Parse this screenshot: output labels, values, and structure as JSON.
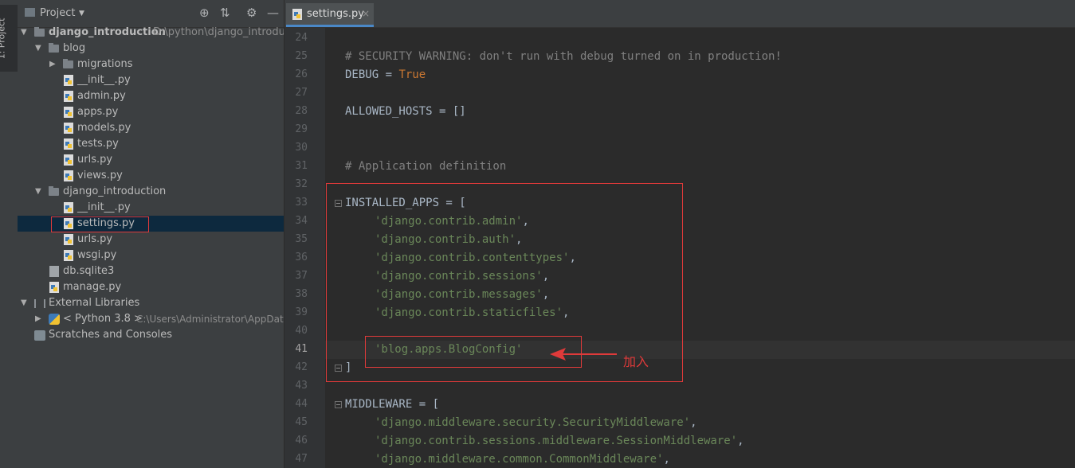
{
  "toolwindow_strip": {
    "label": "1: Project"
  },
  "project_panel": {
    "title": "Project",
    "tree": [
      {
        "label": "django_introduction",
        "hint": "D:\\python\\django_introducti",
        "type": "root"
      },
      {
        "label": "blog",
        "type": "folder"
      },
      {
        "label": "migrations",
        "type": "folder"
      },
      {
        "label": "__init__.py",
        "type": "py"
      },
      {
        "label": "admin.py",
        "type": "py"
      },
      {
        "label": "apps.py",
        "type": "py"
      },
      {
        "label": "models.py",
        "type": "py"
      },
      {
        "label": "tests.py",
        "type": "py"
      },
      {
        "label": "urls.py",
        "type": "py"
      },
      {
        "label": "views.py",
        "type": "py"
      },
      {
        "label": "django_introduction",
        "type": "folder"
      },
      {
        "label": "__init__.py",
        "type": "py"
      },
      {
        "label": "settings.py",
        "type": "py",
        "selected": true
      },
      {
        "label": "urls.py",
        "type": "py"
      },
      {
        "label": "wsgi.py",
        "type": "py"
      },
      {
        "label": "db.sqlite3",
        "type": "db"
      },
      {
        "label": "manage.py",
        "type": "py"
      },
      {
        "label": "External Libraries",
        "type": "lib"
      },
      {
        "label": "< Python 3.8 >",
        "hint": "C:\\Users\\Administrator\\AppData",
        "type": "python"
      },
      {
        "label": "Scratches and Consoles",
        "type": "scratch"
      }
    ]
  },
  "editor": {
    "tab": {
      "label": "settings.py",
      "close": "×"
    },
    "lines": [
      {
        "n": "24",
        "text": ""
      },
      {
        "n": "25",
        "text": "# SECURITY WARNING: don't run with debug turned on in production!"
      },
      {
        "n": "26",
        "a": "DEBUG = ",
        "b": "True"
      },
      {
        "n": "27",
        "text": ""
      },
      {
        "n": "28",
        "text": "ALLOWED_HOSTS = []"
      },
      {
        "n": "29",
        "text": ""
      },
      {
        "n": "30",
        "text": ""
      },
      {
        "n": "31",
        "text": "# Application definition"
      },
      {
        "n": "32",
        "text": ""
      },
      {
        "n": "33",
        "text": "INSTALLED_APPS = ["
      },
      {
        "n": "34",
        "s": "'django.contrib.admin'",
        "p": ","
      },
      {
        "n": "35",
        "s": "'django.contrib.auth'",
        "p": ","
      },
      {
        "n": "36",
        "s": "'django.contrib.contenttypes'",
        "p": ","
      },
      {
        "n": "37",
        "s": "'django.contrib.sessions'",
        "p": ","
      },
      {
        "n": "38",
        "s": "'django.contrib.messages'",
        "p": ","
      },
      {
        "n": "39",
        "s": "'django.contrib.staticfiles'",
        "p": ","
      },
      {
        "n": "40",
        "text": ""
      },
      {
        "n": "41",
        "s": "'blog.apps.BlogConfig'",
        "p": ""
      },
      {
        "n": "42",
        "text": "]"
      },
      {
        "n": "43",
        "text": ""
      },
      {
        "n": "44",
        "text": "MIDDLEWARE = ["
      },
      {
        "n": "45",
        "s": "'django.middleware.security.SecurityMiddleware'",
        "p": ","
      },
      {
        "n": "46",
        "s": "'django.contrib.sessions.middleware.SessionMiddleware'",
        "p": ","
      },
      {
        "n": "47",
        "s": "'django.middleware.common.CommonMiddleware'",
        "p": ","
      }
    ],
    "current_line": "41"
  },
  "annotation": {
    "label": "加入"
  },
  "colors": {
    "highlight": "#e03a3a",
    "selection": "#0d293e",
    "string": "#6a8759",
    "keyword": "#cc7832",
    "comment": "#808080"
  }
}
